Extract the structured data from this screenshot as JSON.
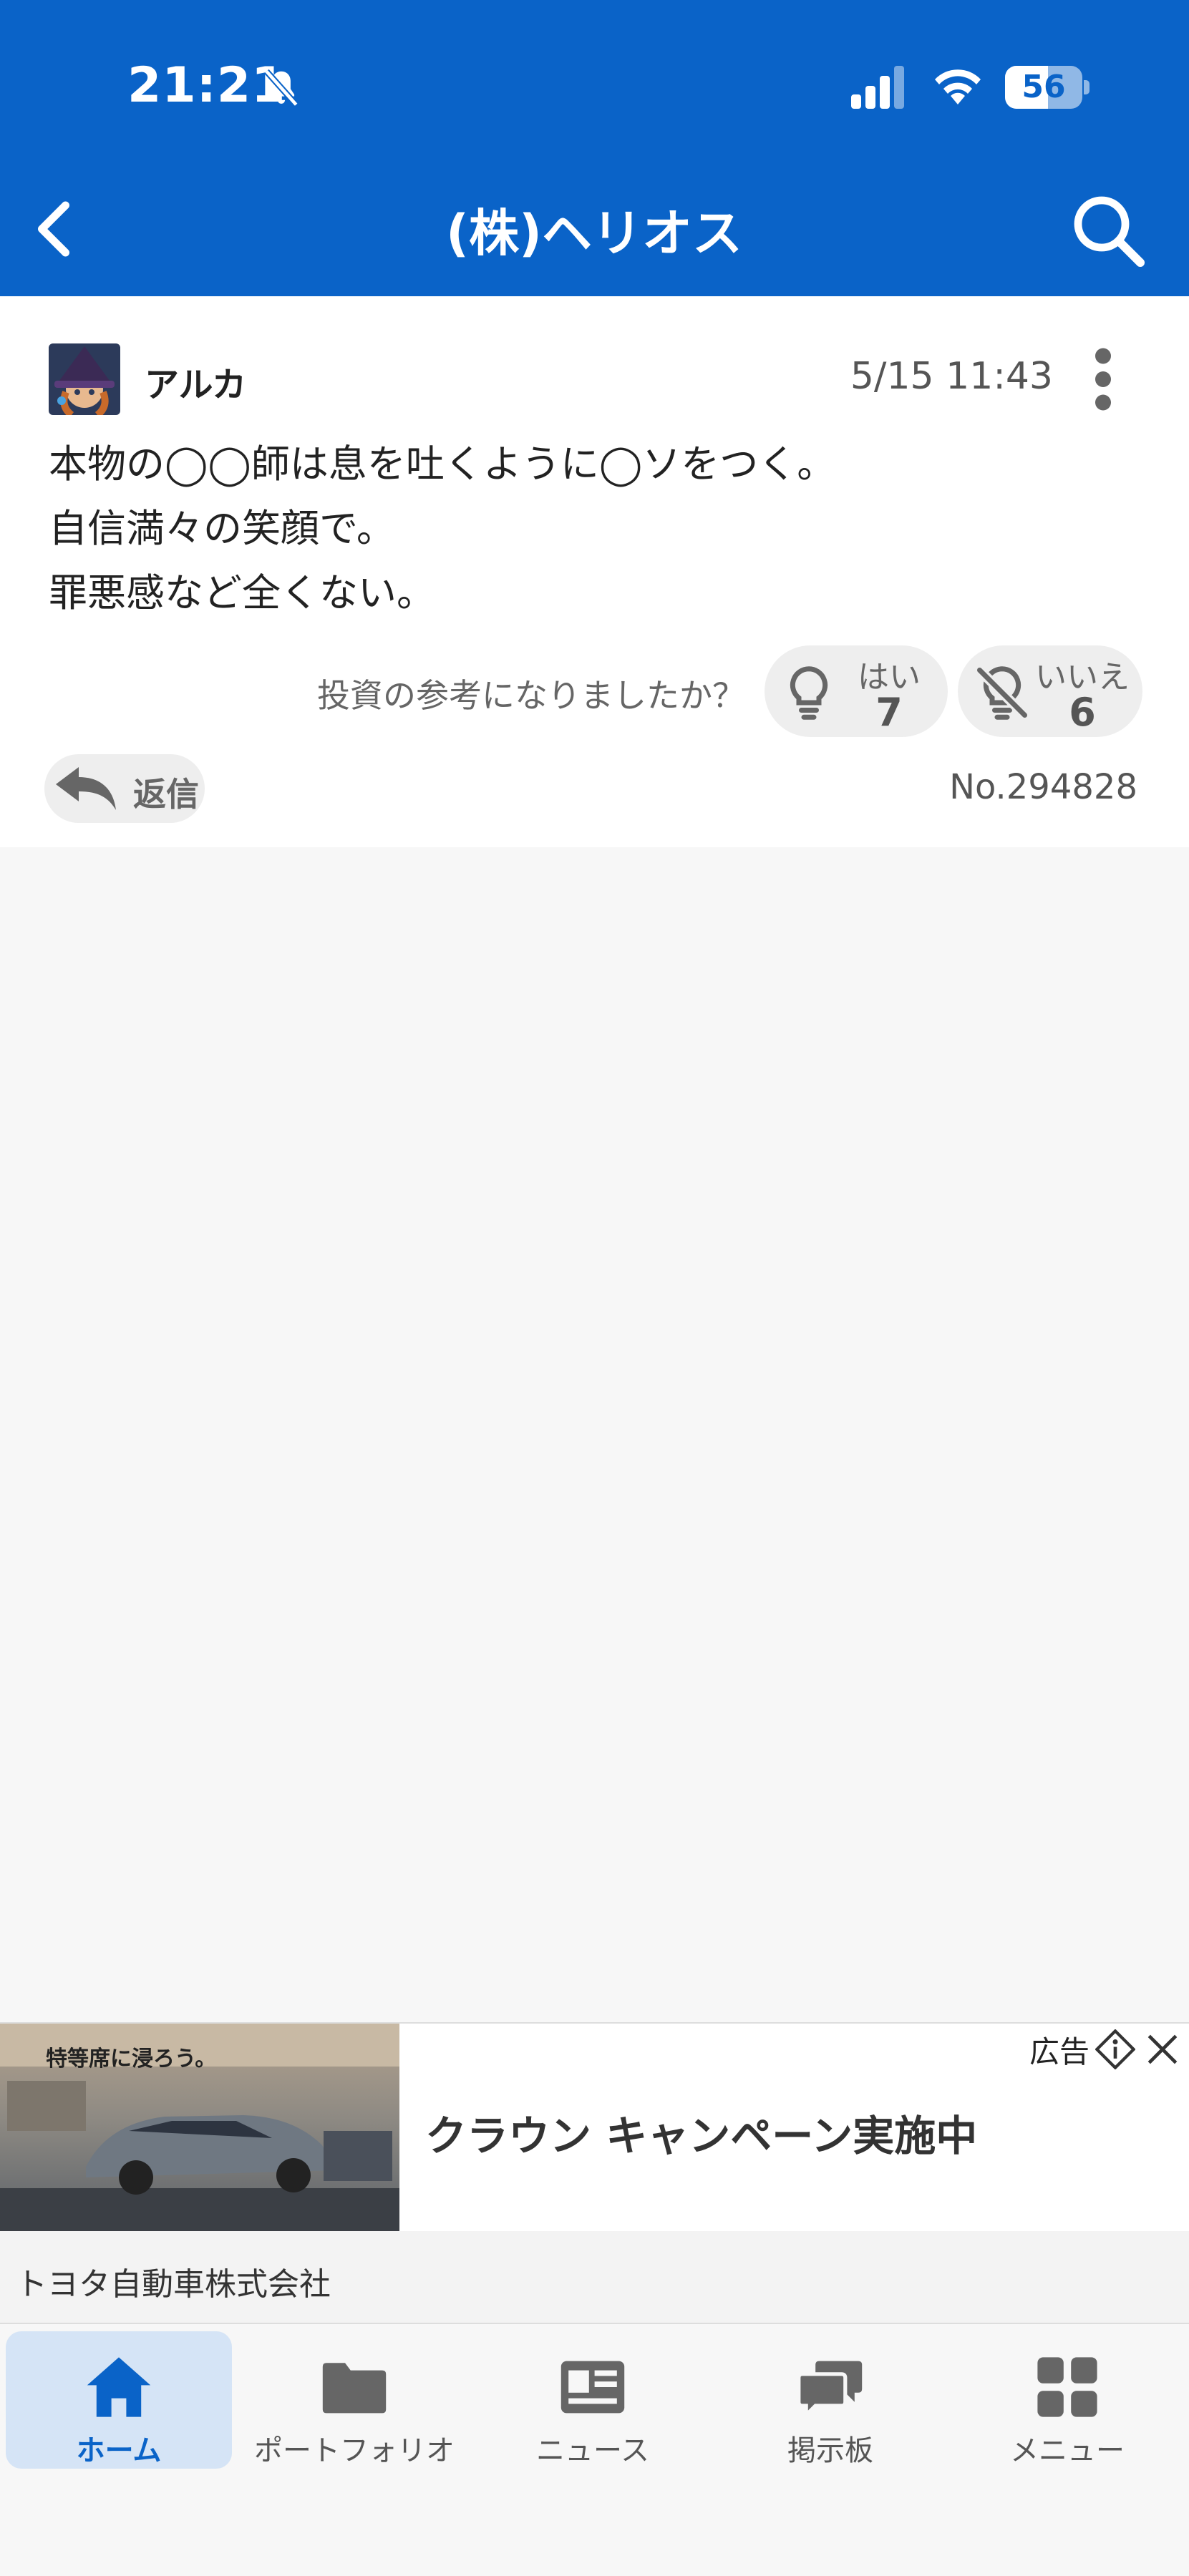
{
  "status_bar": {
    "time": "21:21",
    "battery": "56",
    "battery_level": 0.56
  },
  "header": {
    "title": "(株)ヘリオス"
  },
  "post": {
    "username": "アルカ",
    "timestamp": "5/15 11:43",
    "body_lines": [
      "本物の◯◯師は息を吐くように◯ソをつく。",
      "自信満々の笑顔で。",
      "罪悪感など全くない。"
    ],
    "helpful_question": "投資の参考になりましたか？",
    "vote_yes": {
      "label": "はい",
      "count": "7"
    },
    "vote_no": {
      "label": "いいえ",
      "count": "6"
    },
    "reply_label": "返信",
    "post_number": "No.294828"
  },
  "ad": {
    "label": "広告",
    "headline": "クラウン キャンペーン実施中",
    "image_text": "特等席に浸ろう。",
    "advertiser": "トヨタ自動車株式会社"
  },
  "nav": {
    "items": [
      {
        "label": "ホーム",
        "icon": "home-icon",
        "active": true
      },
      {
        "label": "ポートフォリオ",
        "icon": "folder-icon",
        "active": false
      },
      {
        "label": "ニュース",
        "icon": "newspaper-icon",
        "active": false
      },
      {
        "label": "掲示板",
        "icon": "chat-icon",
        "active": false
      },
      {
        "label": "メニュー",
        "icon": "grid-icon",
        "active": false
      }
    ]
  },
  "colors": {
    "brand": "#0a63c8",
    "active_tab_bg": "#d5e4f6"
  }
}
